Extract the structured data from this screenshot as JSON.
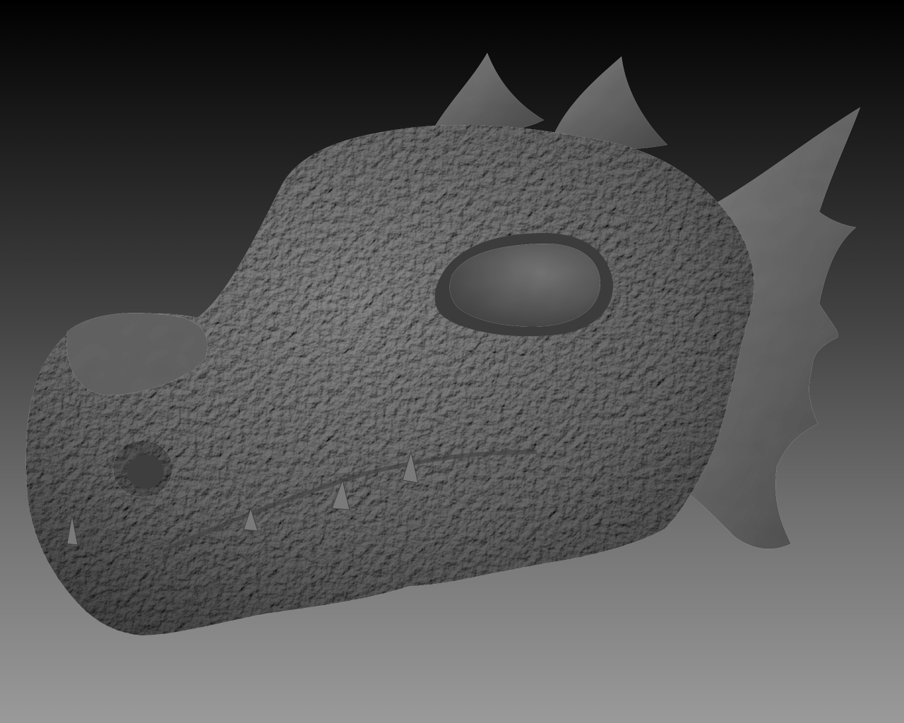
{
  "viewport": {
    "background_top": "#000000",
    "background_bottom": "#9a9a9a",
    "model_color": "#5a5a5a",
    "model_name_icon": "dragon-head-sculpt"
  }
}
